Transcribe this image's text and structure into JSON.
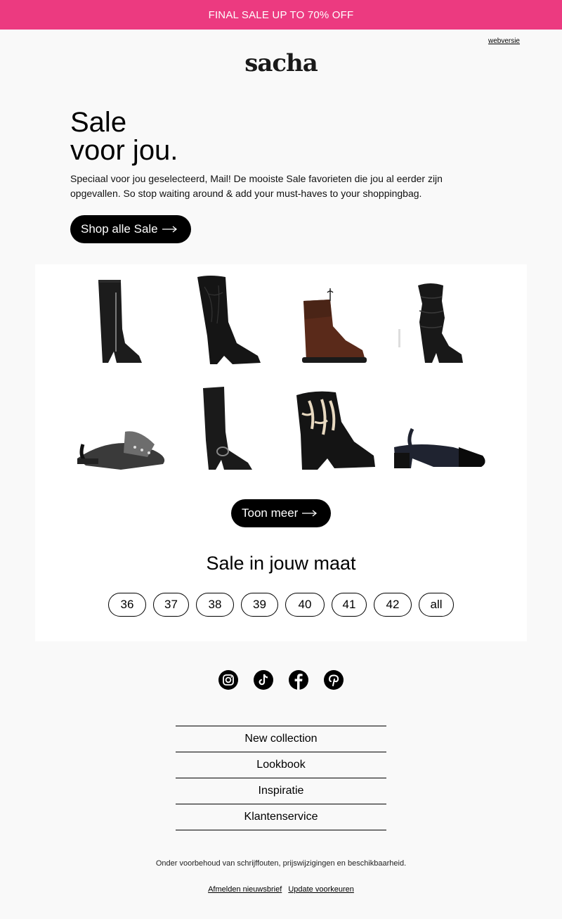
{
  "banner": {
    "text": "FINAL SALE UP TO 70% OFF",
    "color": "#ec3a80"
  },
  "header": {
    "webversion_link": "webversie",
    "logo": "sacha"
  },
  "hero": {
    "title_line1": "Sale",
    "title_line2": "voor jou.",
    "text": "Speciaal voor jou geselecteerd, Mail! De mooiste Sale favorieten die jou al eerder zijn opgevallen. So stop waiting around & add your must-haves to your shoppingbag.",
    "cta_label": "Shop alle Sale"
  },
  "products": [
    {
      "icon": "tall-black-boot-image"
    },
    {
      "icon": "western-black-boot-image"
    },
    {
      "icon": "brown-ankle-boot-image"
    },
    {
      "icon": "slouch-black-boot-image"
    },
    {
      "icon": "slingback-flat-image"
    },
    {
      "icon": "knee-high-harness-boot-image"
    },
    {
      "icon": "western-ankle-boot-image"
    },
    {
      "icon": "slingback-pump-image"
    }
  ],
  "more_label": "Toon meer",
  "size_section": {
    "title": "Sale in jouw maat",
    "sizes": [
      "36",
      "37",
      "38",
      "39",
      "40",
      "41",
      "42",
      "all"
    ]
  },
  "social": [
    "instagram-icon",
    "tiktok-icon",
    "facebook-icon",
    "pinterest-icon"
  ],
  "footer_nav": [
    "New collection",
    "Lookbook",
    "Inspiratie",
    "Klantenservice"
  ],
  "disclaimer": "Onder voorbehoud van schrijffouten, prijswijzigingen en beschikbaarheid.",
  "footer_links": {
    "unsubscribe": "Afmelden nieuwsbrief",
    "preferences": "Update voorkeuren"
  }
}
